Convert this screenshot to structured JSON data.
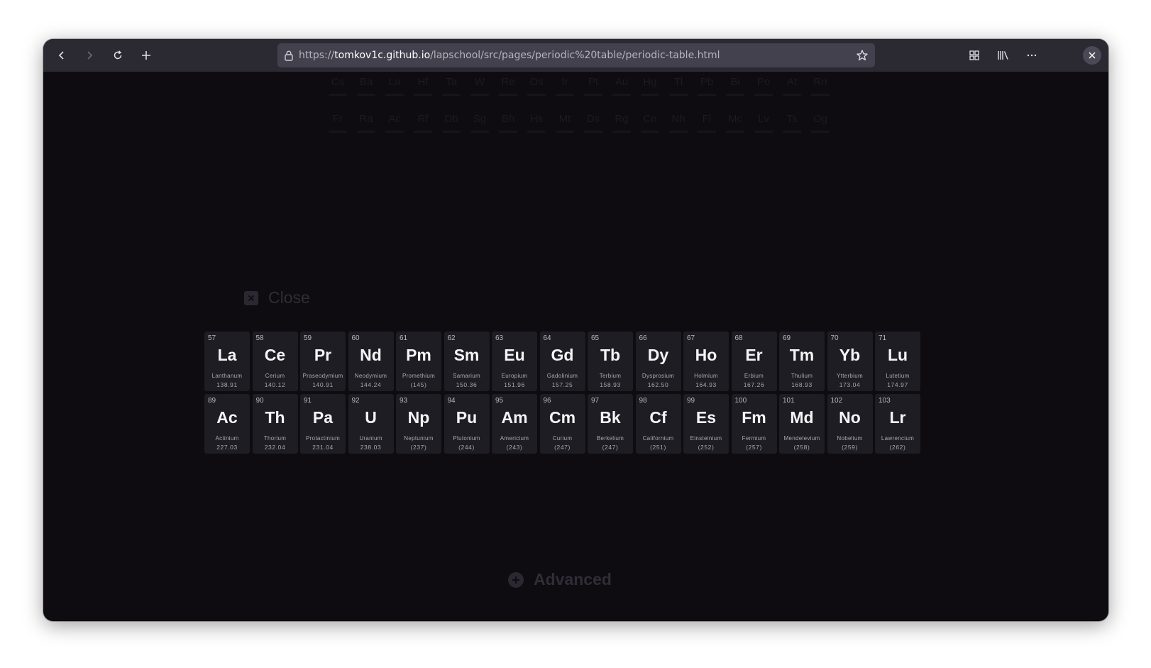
{
  "browser": {
    "url_scheme": "https://",
    "url_host": "tomkov1c.github.io",
    "url_path": "/lapschool/src/pages/periodic%20table/periodic-table.html",
    "icons": [
      "back-icon",
      "forward-icon",
      "reload-icon",
      "new-tab-icon",
      "lock-icon",
      "bookmark-star-icon",
      "extensions-icon",
      "library-icon",
      "menu-icon",
      "close-icon"
    ]
  },
  "background_table": {
    "row6": [
      "Cs",
      "Ba",
      "La",
      "Hf",
      "Ta",
      "W",
      "Re",
      "Os",
      "Ir",
      "Pt",
      "Au",
      "Hg",
      "Tl",
      "Pb",
      "Bi",
      "Po",
      "At",
      "Rn"
    ],
    "row7": [
      "Fr",
      "Ra",
      "Ac",
      "Rf",
      "Db",
      "Sg",
      "Bh",
      "Hs",
      "Mt",
      "Ds",
      "Rg",
      "Cn",
      "Nh",
      "Fl",
      "Mc",
      "Lv",
      "Ts",
      "Og"
    ]
  },
  "modal": {
    "close_label": "Close",
    "lanthanides": [
      {
        "num": "57",
        "sym": "La",
        "name": "Lanthanum",
        "mass": "138.91"
      },
      {
        "num": "58",
        "sym": "Ce",
        "name": "Cerium",
        "mass": "140.12"
      },
      {
        "num": "59",
        "sym": "Pr",
        "name": "Praseodymium",
        "mass": "140.91"
      },
      {
        "num": "60",
        "sym": "Nd",
        "name": "Neodymium",
        "mass": "144.24"
      },
      {
        "num": "61",
        "sym": "Pm",
        "name": "Promethium",
        "mass": "(145)"
      },
      {
        "num": "62",
        "sym": "Sm",
        "name": "Samarium",
        "mass": "150.36"
      },
      {
        "num": "63",
        "sym": "Eu",
        "name": "Europium",
        "mass": "151.96"
      },
      {
        "num": "64",
        "sym": "Gd",
        "name": "Gadolinium",
        "mass": "157.25"
      },
      {
        "num": "65",
        "sym": "Tb",
        "name": "Terbium",
        "mass": "158.93"
      },
      {
        "num": "66",
        "sym": "Dy",
        "name": "Dysprosium",
        "mass": "162.50"
      },
      {
        "num": "67",
        "sym": "Ho",
        "name": "Holmium",
        "mass": "164.93"
      },
      {
        "num": "68",
        "sym": "Er",
        "name": "Erbium",
        "mass": "167.26"
      },
      {
        "num": "69",
        "sym": "Tm",
        "name": "Thulium",
        "mass": "168.93"
      },
      {
        "num": "70",
        "sym": "Yb",
        "name": "Ytterbium",
        "mass": "173.04"
      },
      {
        "num": "71",
        "sym": "Lu",
        "name": "Lutetium",
        "mass": "174.97"
      }
    ],
    "actinides": [
      {
        "num": "89",
        "sym": "Ac",
        "name": "Actinium",
        "mass": "227.03"
      },
      {
        "num": "90",
        "sym": "Th",
        "name": "Thorium",
        "mass": "232.04"
      },
      {
        "num": "91",
        "sym": "Pa",
        "name": "Protactinium",
        "mass": "231.04"
      },
      {
        "num": "92",
        "sym": "U",
        "name": "Uranium",
        "mass": "238.03"
      },
      {
        "num": "93",
        "sym": "Np",
        "name": "Neptunium",
        "mass": "(237)"
      },
      {
        "num": "94",
        "sym": "Pu",
        "name": "Plutonium",
        "mass": "(244)"
      },
      {
        "num": "95",
        "sym": "Am",
        "name": "Americium",
        "mass": "(243)"
      },
      {
        "num": "96",
        "sym": "Cm",
        "name": "Curium",
        "mass": "(247)"
      },
      {
        "num": "97",
        "sym": "Bk",
        "name": "Berkelium",
        "mass": "(247)"
      },
      {
        "num": "98",
        "sym": "Cf",
        "name": "Californium",
        "mass": "(251)"
      },
      {
        "num": "99",
        "sym": "Es",
        "name": "Einsteinium",
        "mass": "(252)"
      },
      {
        "num": "100",
        "sym": "Fm",
        "name": "Fermium",
        "mass": "(257)"
      },
      {
        "num": "101",
        "sym": "Md",
        "name": "Mendelevium",
        "mass": "(258)"
      },
      {
        "num": "102",
        "sym": "No",
        "name": "Nobelium",
        "mass": "(259)"
      },
      {
        "num": "103",
        "sym": "Lr",
        "name": "Lawrencium",
        "mass": "(262)"
      }
    ]
  },
  "footer": {
    "advanced_label": "Advanced"
  },
  "colors": {
    "page_bg": "#0e0c11",
    "tile_bg": "#1e1d23",
    "toolbar_bg": "#2b2a33",
    "urlbar_bg": "#42414d"
  }
}
